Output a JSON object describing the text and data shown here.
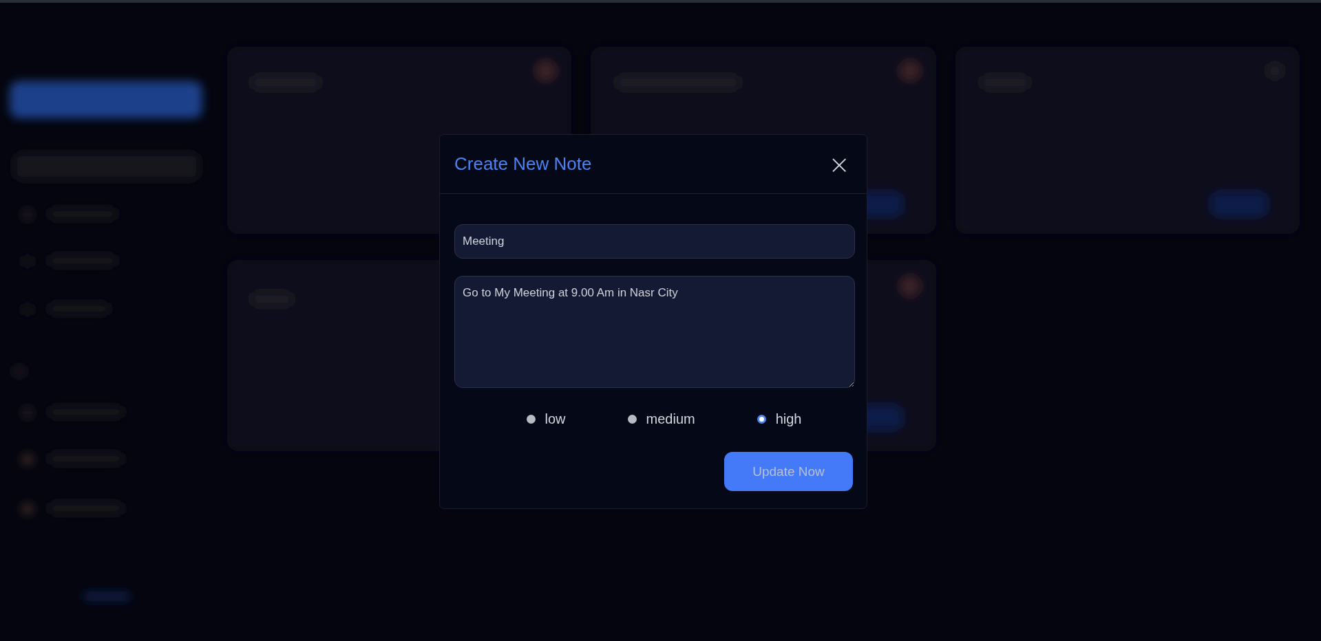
{
  "dialog": {
    "title": "Create New Note",
    "close": "×",
    "title_field": {
      "value": "Meeting"
    },
    "body_field": {
      "value": "Go to My Meeting at 9.00 Am in Nasr City"
    },
    "priority": [
      {
        "label": "low",
        "selected": false
      },
      {
        "label": "medium",
        "selected": false
      },
      {
        "label": "high",
        "selected": true
      }
    ],
    "submit": "Update Now"
  }
}
